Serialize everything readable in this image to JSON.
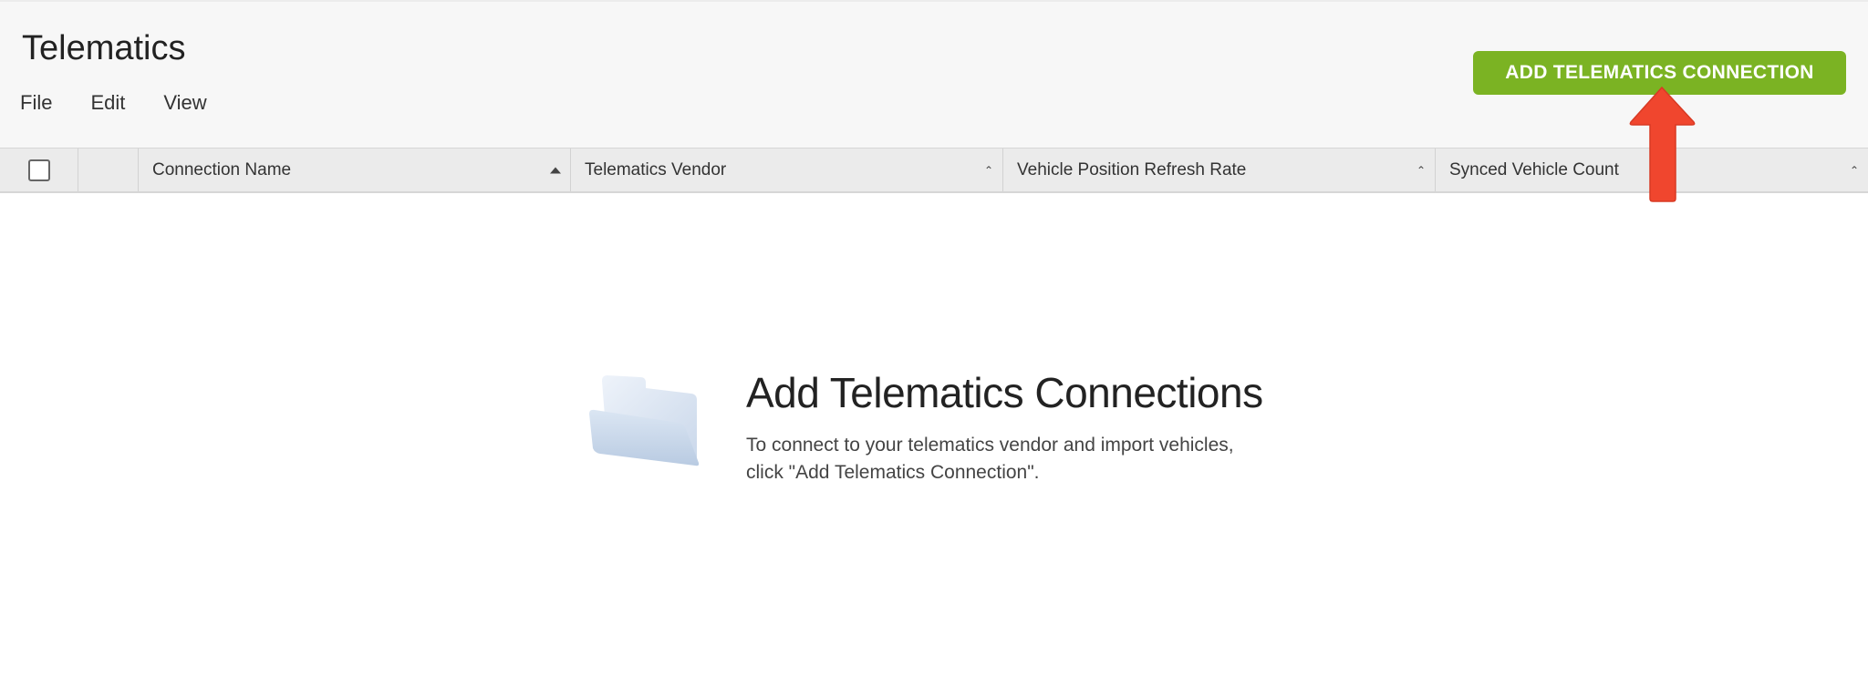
{
  "header": {
    "title": "Telematics",
    "menu": [
      "File",
      "Edit",
      "View"
    ],
    "add_button_label": "ADD TELEMATICS CONNECTION",
    "accent_color": "#7bb323"
  },
  "grid": {
    "columns": [
      {
        "label": "Connection Name",
        "sort": "ascending-active"
      },
      {
        "label": "Telematics Vendor",
        "sort": "ascending"
      },
      {
        "label": "Vehicle Position Refresh Rate",
        "sort": "ascending"
      },
      {
        "label": "Synced Vehicle Count",
        "sort": "ascending"
      }
    ],
    "rows": []
  },
  "empty_state": {
    "icon": "folder-icon",
    "title": "Add Telematics Connections",
    "line1": "To connect to your telematics vendor and import vehicles,",
    "line2": "click \"Add Telematics Connection\"."
  },
  "annotation": {
    "icon": "arrow-up-icon",
    "color": "#f0462e"
  }
}
